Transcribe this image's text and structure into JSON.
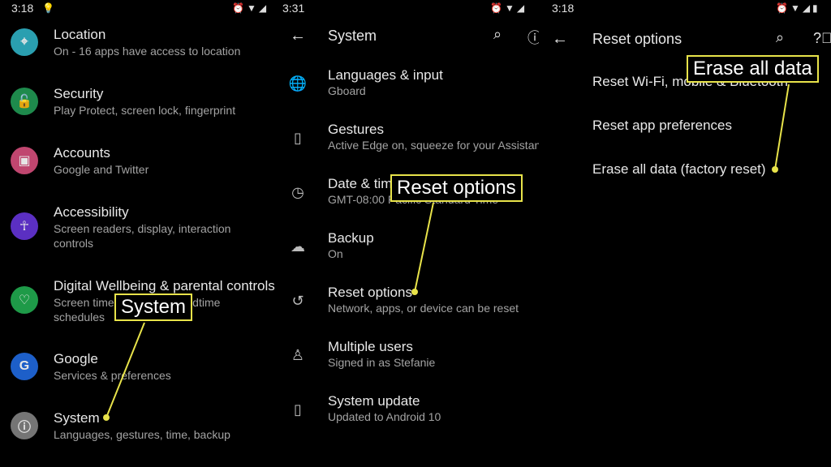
{
  "panel1": {
    "status_time": "3:18",
    "items": [
      {
        "title": "Location",
        "subtitle": "On - 16 apps have access to location",
        "icon": "location-pin-icon",
        "color": "#2a9fb0"
      },
      {
        "title": "Security",
        "subtitle": "Play Protect, screen lock, fingerprint",
        "icon": "unlock-icon",
        "color": "#1e8a4c"
      },
      {
        "title": "Accounts",
        "subtitle": "Google and Twitter",
        "icon": "account-box-icon",
        "color": "#c0466f"
      },
      {
        "title": "Accessibility",
        "subtitle": "Screen readers, display, interaction controls",
        "icon": "accessibility-icon",
        "color": "#5b2fc2"
      },
      {
        "title": "Digital Wellbeing & parental controls",
        "subtitle": "Screen time, app timers, bedtime schedules",
        "icon": "wellbeing-icon",
        "color": "#1e9a48"
      },
      {
        "title": "Google",
        "subtitle": "Services & preferences",
        "icon": "google-icon",
        "color": "#1d5fc9"
      },
      {
        "title": "System",
        "subtitle": "Languages, gestures, time, backup",
        "icon": "info-icon",
        "color": "#757575"
      }
    ]
  },
  "panel2": {
    "status_time": "3:31",
    "header": "System",
    "items": [
      {
        "title": "Languages & input",
        "subtitle": "Gboard",
        "icon": "globe-icon"
      },
      {
        "title": "Gestures",
        "subtitle": "Active Edge on, squeeze for your Assistant",
        "icon": "gesture-phone-icon"
      },
      {
        "title": "Date & time",
        "subtitle": "GMT-08:00 Pacific Standard Time",
        "icon": "clock-icon"
      },
      {
        "title": "Backup",
        "subtitle": "On",
        "icon": "cloud-upload-icon"
      },
      {
        "title": "Reset options",
        "subtitle": "Network, apps, or device can be reset",
        "icon": "history-icon"
      },
      {
        "title": "Multiple users",
        "subtitle": "Signed in as Stefanie",
        "icon": "person-icon"
      },
      {
        "title": "System update",
        "subtitle": "Updated to Android 10",
        "icon": "system-update-icon"
      }
    ]
  },
  "panel3": {
    "status_time": "3:18",
    "header": "Reset options",
    "items": [
      {
        "title": "Reset Wi-Fi, mobile & Bluetooth"
      },
      {
        "title": "Reset app preferences"
      },
      {
        "title": "Erase all data (factory reset)"
      }
    ]
  },
  "callouts": {
    "system": "System",
    "reset_options": "Reset options",
    "erase_all_data": "Erase all data"
  },
  "colors": {
    "callout": "#e8e34a",
    "background": "#000000"
  }
}
